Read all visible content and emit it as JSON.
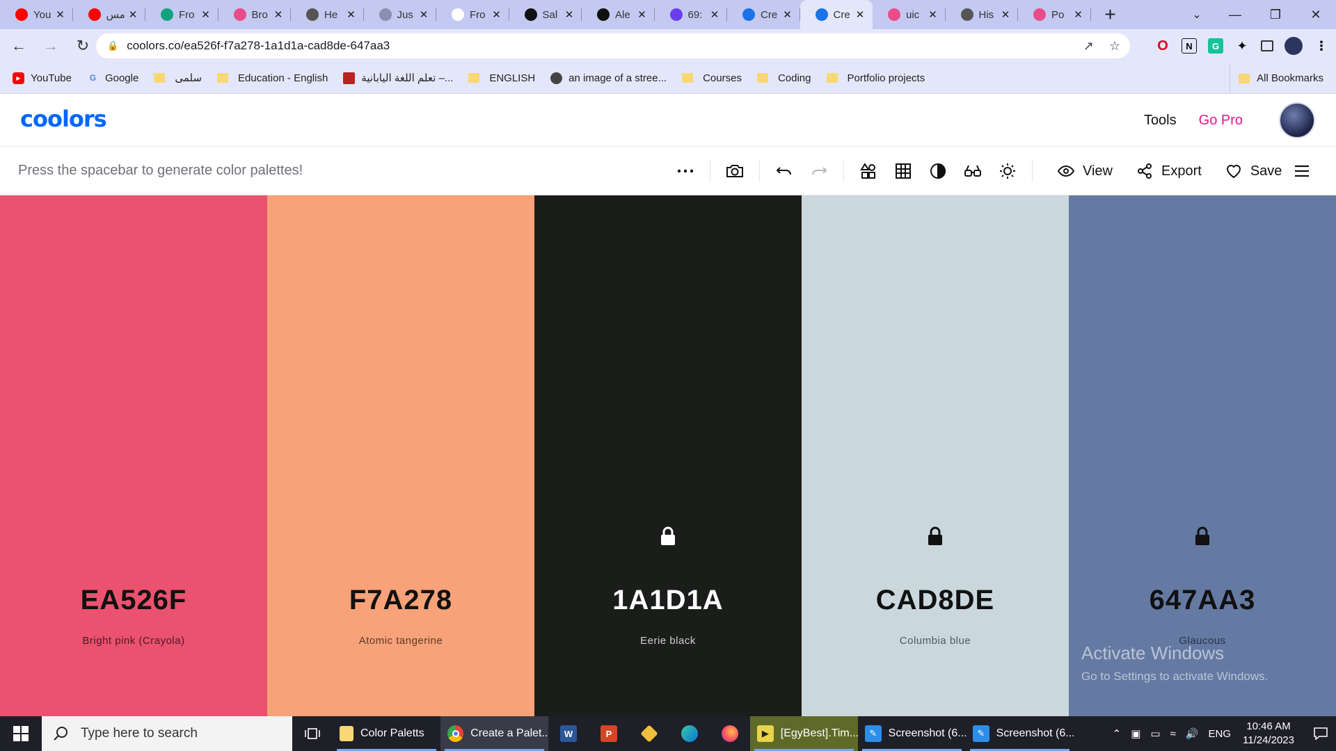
{
  "browser": {
    "tabs": [
      {
        "title": "You",
        "icon": "youtube-icon",
        "color": "#ff0000"
      },
      {
        "title": "مس",
        "icon": "youtube-icon",
        "color": "#ff0000"
      },
      {
        "title": "Fro",
        "icon": "openai-icon",
        "color": "#10a37f"
      },
      {
        "title": "Bro",
        "icon": "dribbble-icon",
        "color": "#ea4c89"
      },
      {
        "title": "He",
        "icon": "globe-icon",
        "color": "#555555"
      },
      {
        "title": "Jus",
        "icon": "circle-icon",
        "color": "#8a8fb3"
      },
      {
        "title": "Fro",
        "icon": "openai-icon",
        "color": "#ffffff"
      },
      {
        "title": "Sal",
        "icon": "dollar-icon",
        "color": "#111111"
      },
      {
        "title": "Ale",
        "icon": "triangle-icon",
        "color": "#111111"
      },
      {
        "title": "69:",
        "icon": "ui-icon",
        "color": "#6a3df0"
      },
      {
        "title": "Cre",
        "icon": "coolors-icon",
        "color": "#1a73e8"
      },
      {
        "title": "Cre",
        "icon": "coolors-icon",
        "color": "#1a73e8",
        "active": true
      },
      {
        "title": "uic",
        "icon": "dribbble-icon",
        "color": "#ea4c89"
      },
      {
        "title": "His",
        "icon": "history-icon",
        "color": "#555555"
      },
      {
        "title": "Po",
        "icon": "dribbble-icon",
        "color": "#ea4c89"
      }
    ],
    "url": "coolors.co/ea526f-f7a278-1a1d1a-cad8de-647aa3",
    "bookmarks": [
      {
        "label": "YouTube",
        "icon": "youtube-icon"
      },
      {
        "label": "Google",
        "icon": "google-icon"
      },
      {
        "label": "سلمى",
        "icon": "folder-icon"
      },
      {
        "label": "Education - English",
        "icon": "folder-icon"
      },
      {
        "label": "تعلم اللغة اليابانية –...",
        "icon": "site-icon"
      },
      {
        "label": "ENGLISH",
        "icon": "folder-icon"
      },
      {
        "label": "an image of a stree...",
        "icon": "globe-icon"
      },
      {
        "label": "Courses",
        "icon": "folder-icon"
      },
      {
        "label": "Coding",
        "icon": "folder-icon"
      },
      {
        "label": "Portfolio projects",
        "icon": "folder-icon"
      }
    ],
    "all_bookmarks": "All Bookmarks"
  },
  "app": {
    "logo": "coolors",
    "nav": {
      "tools": "Tools",
      "go_pro": "Go Pro"
    },
    "hint": "Press the spacebar to generate color palettes!",
    "actions": {
      "view": "View",
      "export": "Export",
      "save": "Save"
    }
  },
  "palette": [
    {
      "hex": "EA526F",
      "name": "Bright pink (Crayola)",
      "bg": "#ea526f",
      "fg": "#111111",
      "sub": "#4a1a24",
      "locked": false
    },
    {
      "hex": "F7A278",
      "name": "Atomic tangerine",
      "bg": "#f7a278",
      "fg": "#111111",
      "sub": "#5a3a2a",
      "locked": false
    },
    {
      "hex": "1A1D1A",
      "name": "Eerie black",
      "bg": "#1a1d1a",
      "fg": "#ffffff",
      "sub": "#cfcfcf",
      "locked": true
    },
    {
      "hex": "CAD8DE",
      "name": "Columbia blue",
      "bg": "#cad8de",
      "fg": "#111111",
      "sub": "#4f5a60",
      "locked": true
    },
    {
      "hex": "647AA3",
      "name": "Glaucous",
      "bg": "#647aa3",
      "fg": "#111111",
      "sub": "#26304a",
      "locked": true
    }
  ],
  "watermark": {
    "line1": "Activate Windows",
    "line2": "Go to Settings to activate Windows."
  },
  "taskbar": {
    "search_placeholder": "Type here to search",
    "apps": [
      {
        "label": "Color Paletts",
        "icon": "file-explorer-icon"
      },
      {
        "label": "Create a Palet...",
        "icon": "chrome-icon"
      },
      {
        "label": "[EgyBest].Tim...",
        "icon": "media-player-icon"
      },
      {
        "label": "Screenshot (6...",
        "icon": "paint-icon"
      },
      {
        "label": "Screenshot (6...",
        "icon": "paint-icon"
      }
    ],
    "language": "ENG",
    "time": "10:46 AM",
    "date": "11/24/2023"
  }
}
